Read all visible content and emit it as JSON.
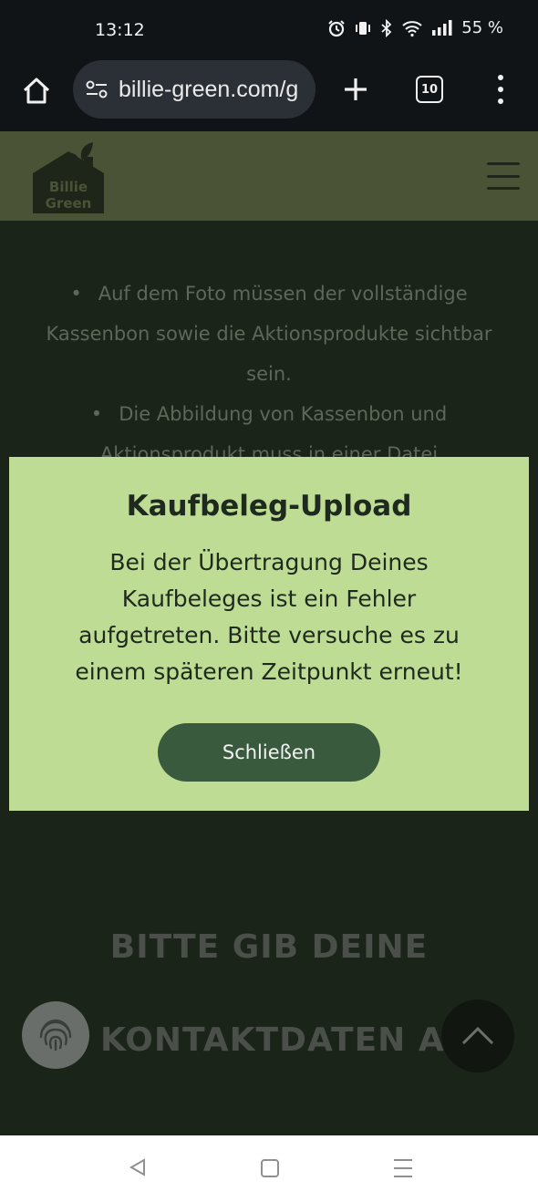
{
  "status_bar": {
    "time": "13:12",
    "battery": "55 %",
    "icons": [
      "alarm-icon",
      "vibrate-icon",
      "bluetooth-icon",
      "wifi-icon",
      "signal-icon"
    ]
  },
  "browser": {
    "url": "billie-green.com/g",
    "tab_count": "10",
    "icons": [
      "home-icon",
      "site-settings-icon",
      "plus-icon",
      "more-vert-icon"
    ]
  },
  "site": {
    "logo_text_1": "Billie",
    "logo_text_2": "Green",
    "colors": {
      "header": "#4a5336",
      "background": "#1a2419",
      "modal": "#bedc94",
      "button": "#3a5a3e"
    }
  },
  "page": {
    "bullets": [
      "Auf dem Foto müssen der vollständige Kassenbon sowie die Aktionsprodukte sichtbar sein.",
      "Die Abbildung von Kassenbon und Aktionsprodukt muss in einer Datei hochgeladen"
    ],
    "heading_line_1": "BITTE GIB DEINE",
    "heading_line_2": "KONTAKTDATEN AN"
  },
  "modal": {
    "title": "Kaufbeleg-Upload",
    "message": "Bei der Übertragung Deines Kaufbeleges ist ein Fehler aufgetreten. Bitte versuche es zu einem späteren Zeitpunkt erneut!",
    "close_label": "Schließen"
  }
}
